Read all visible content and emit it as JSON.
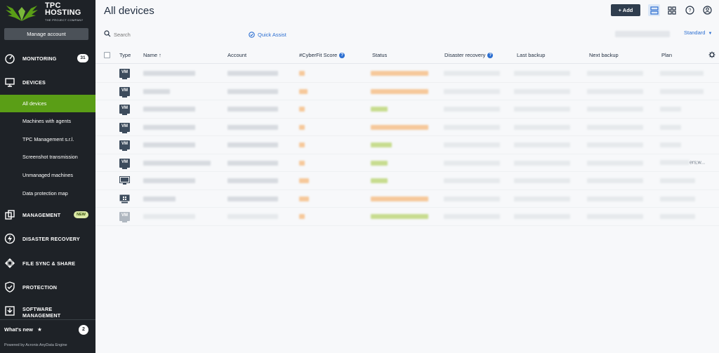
{
  "app": {
    "logo_line1": "TPC",
    "logo_line2": "HOSTING",
    "logo_tagline": "THE PROJECT COMPANY",
    "manage_account": "Manage account"
  },
  "sidebar": {
    "sections": [
      {
        "label": "MONITORING",
        "badge": "31",
        "icon": "speedometer-icon"
      },
      {
        "label": "DEVICES",
        "icon": "monitor-icon"
      },
      {
        "label": "MANAGEMENT",
        "badge": "NEW",
        "icon": "copy-icon"
      },
      {
        "label": "DISASTER RECOVERY",
        "icon": "lightning-icon"
      },
      {
        "label": "FILE SYNC & SHARE",
        "icon": "sync-icon"
      },
      {
        "label": "PROTECTION",
        "icon": "shield-icon"
      },
      {
        "label": "SOFTWARE MANAGEMENT",
        "icon": "install-icon"
      }
    ],
    "device_items": [
      "All devices",
      "Machines with agents",
      "TPC Management s.r.l.",
      "Screenshot transmission",
      "Unmanaged machines",
      "Data protection map"
    ],
    "active_item": "All devices",
    "whats_new": "What's new",
    "whats_new_count": "2",
    "powered_by": "Powered by Acronis AnyData Engine"
  },
  "header": {
    "title": "All devices",
    "add_label": "Add"
  },
  "toolbar": {
    "search_placeholder": "Search",
    "quick_assist": "Quick Assist",
    "view_mode": "Standard"
  },
  "table": {
    "columns": [
      "Type",
      "Name",
      "Account",
      "#CyberFit Score",
      "Status",
      "Disaster recovery",
      "Last backup",
      "Next backup",
      "Plan"
    ],
    "sort_indicator": "↑",
    "rows": [
      {
        "type": "VM",
        "status_color": "orange"
      },
      {
        "type": "VM",
        "status_color": "orange"
      },
      {
        "type": "VM",
        "status_color": "green"
      },
      {
        "type": "VM",
        "status_color": "orange"
      },
      {
        "type": "VM",
        "status_color": "green"
      },
      {
        "type": "VM",
        "status_color": "green",
        "plan_text": "ers;w..."
      },
      {
        "type": "Linux",
        "status_color": "green"
      },
      {
        "type": "Windows",
        "status_color": "orange"
      },
      {
        "type": "VM",
        "status_color": "green",
        "faded": true
      }
    ]
  },
  "colors": {
    "sidebar_bg": "#1e2227",
    "active_green": "#5a9e16",
    "accent_blue": "#2c6fd1",
    "add_button": "#2f3d4e"
  }
}
